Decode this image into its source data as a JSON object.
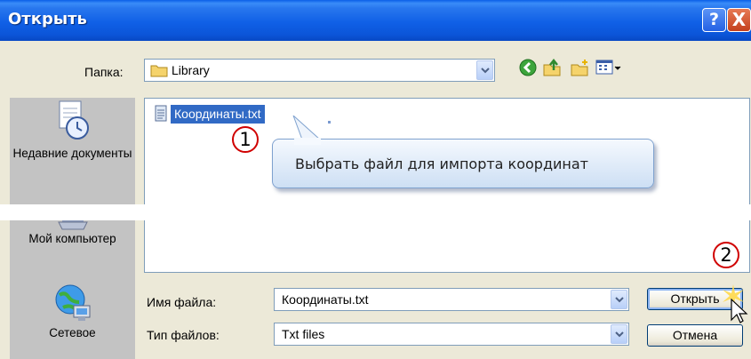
{
  "window": {
    "title": "Открыть",
    "help_label": "?",
    "close_label": "X"
  },
  "lookin": {
    "label": "Папка:",
    "value": "Library"
  },
  "places": [
    {
      "label": "Недавние документы",
      "icon": "recent-documents-icon"
    },
    {
      "label": "Мой компьютер",
      "icon": "my-computer-icon"
    },
    {
      "label": "Сетевое",
      "icon": "network-icon"
    }
  ],
  "files": [
    {
      "name": "Координаты.txt",
      "icon": "text-file-icon",
      "selected": true
    }
  ],
  "callouts": [
    {
      "number": "1",
      "text": "Выбрать файл для импорта координат"
    },
    {
      "number": "2"
    }
  ],
  "filename": {
    "label": "Имя файла:",
    "value": "Координаты.txt"
  },
  "filetype": {
    "label": "Тип файлов:",
    "value": "Txt files"
  },
  "buttons": {
    "open": "Открыть",
    "cancel": "Отмена"
  },
  "colors": {
    "titlebar": "#0b55d8",
    "dialog_bg": "#ece9d8",
    "selection": "#316ac5",
    "badge_border": "#d00000"
  }
}
